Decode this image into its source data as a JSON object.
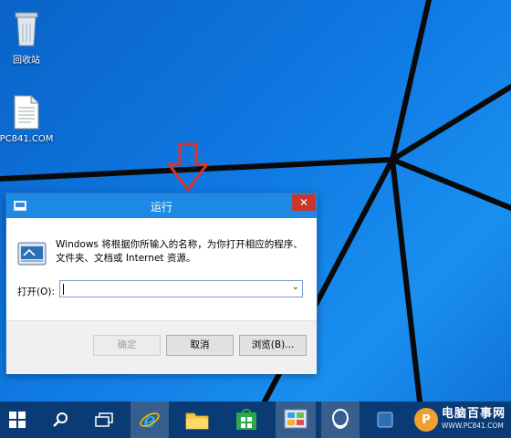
{
  "desktop": {
    "icons": [
      {
        "label": "回收站",
        "icon": "recycle-bin-icon"
      },
      {
        "label": "PC841.COM",
        "icon": "text-file-icon"
      }
    ]
  },
  "dialog": {
    "title": "运行",
    "close_glyph": "✕",
    "description": "Windows 将根据你所输入的名称，为你打开相应的程序、文件夹、文档或 Internet 资源。",
    "open_label": "打开(O):",
    "input_value": "",
    "dropdown_glyph": "⌄",
    "buttons": {
      "ok": "确定",
      "cancel": "取消",
      "browse": "浏览(B)..."
    }
  },
  "taskbar": {
    "items": [
      "start-icon",
      "search-icon",
      "task-view-icon",
      "internet-explorer-icon",
      "file-explorer-icon",
      "store-icon",
      "control-panel-icon",
      "qq-icon"
    ],
    "active": [
      "internet-explorer-icon",
      "control-panel-icon",
      "qq-icon"
    ]
  },
  "watermark": {
    "badge": "P",
    "title": "电脑百事网",
    "url": "WWW.PC841.COM"
  },
  "colors": {
    "accent": "#1e88e5",
    "close": "#c8362e",
    "arrow": "#d9342b",
    "taskbar": "#0b3b74"
  }
}
